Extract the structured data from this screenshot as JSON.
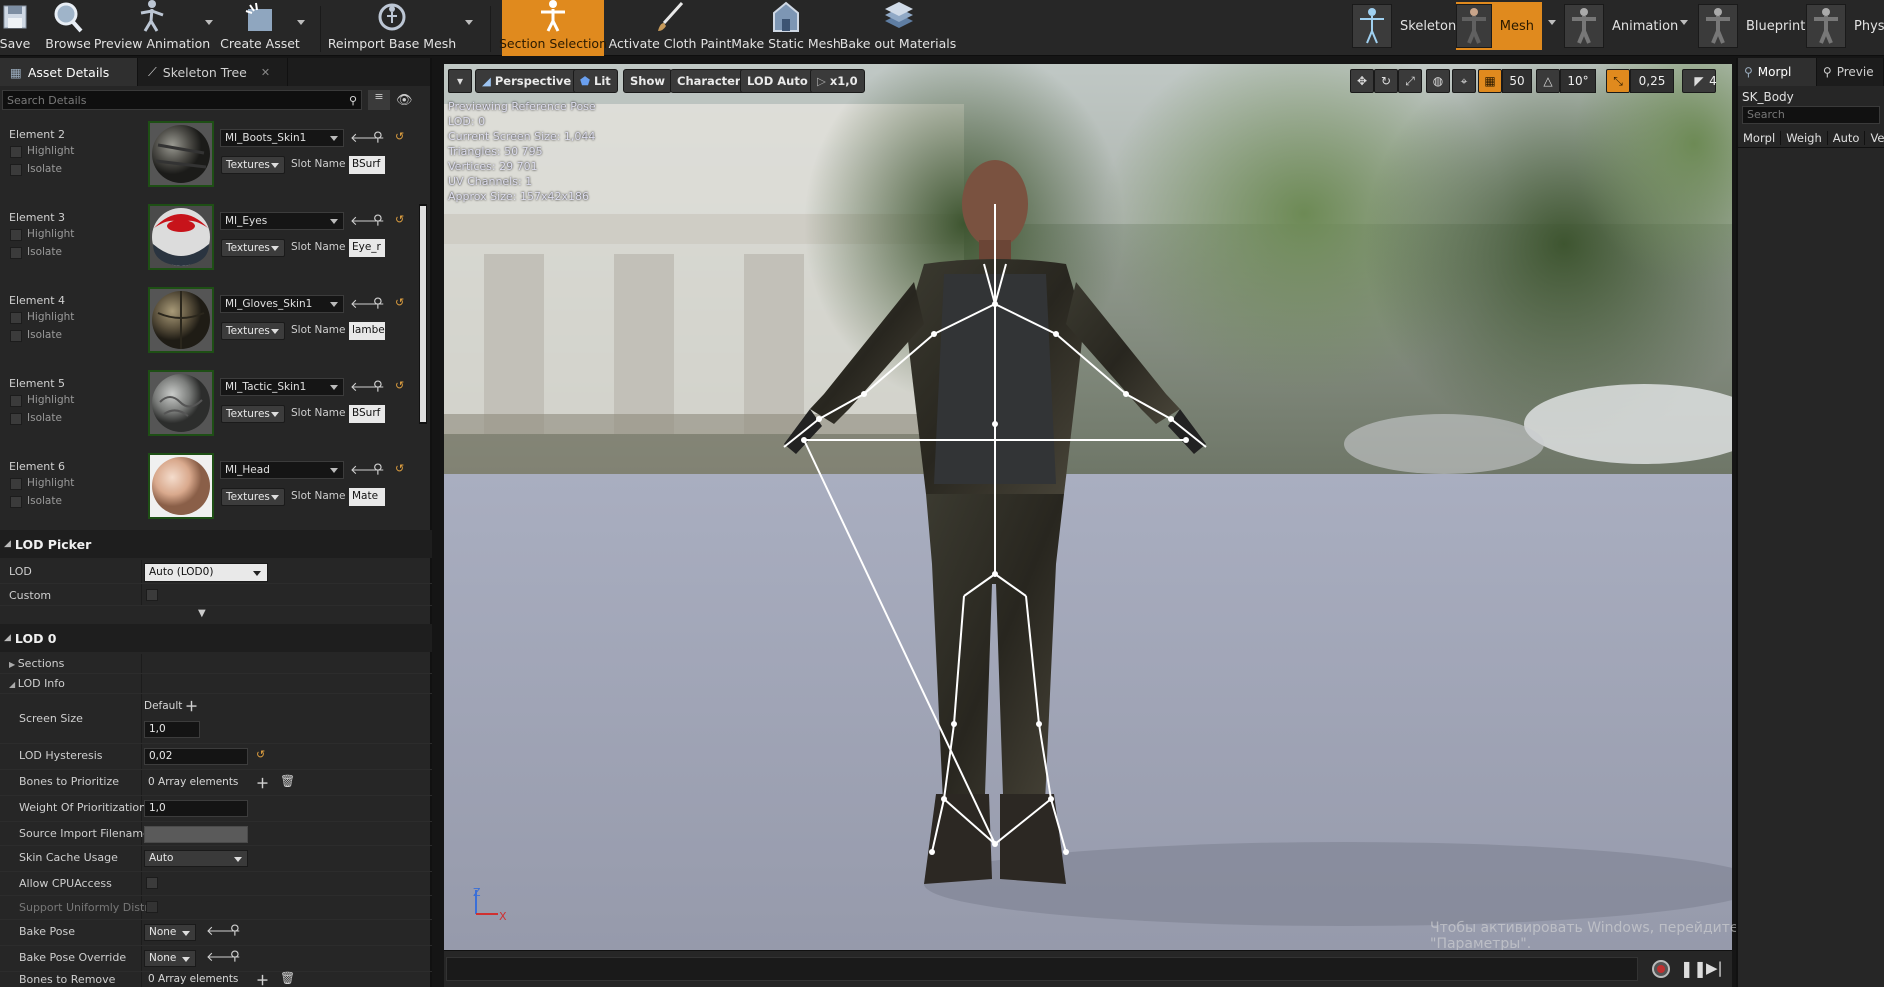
{
  "toolbar": {
    "save": "Save",
    "browse": "Browse",
    "preview_animation": "Preview Animation",
    "create_asset": "Create Asset",
    "reimport_base_mesh": "Reimport Base Mesh",
    "section_selection": "Section Selection",
    "activate_cloth_paint": "Activate Cloth Paint",
    "make_static_mesh": "Make Static Mesh",
    "bake_out_materials": "Bake out Materials"
  },
  "modes": {
    "skeleton": "Skeleton",
    "mesh": "Mesh",
    "animation": "Animation",
    "blueprint": "Blueprint",
    "physics": "Phys"
  },
  "left_panel": {
    "tabs": [
      "Asset Details",
      "Skeleton Tree"
    ],
    "search_placeholder": "Search Details",
    "elements": [
      {
        "name": "Element 2",
        "highlight": "Highlight",
        "isolate": "Isolate",
        "material": "MI_Boots_Skin1",
        "textures": "Textures",
        "slot_label": "Slot Name",
        "slot_value": "BSurf"
      },
      {
        "name": "Element 3",
        "highlight": "Highlight",
        "isolate": "Isolate",
        "material": "MI_Eyes",
        "textures": "Textures",
        "slot_label": "Slot Name",
        "slot_value": "Eye_r"
      },
      {
        "name": "Element 4",
        "highlight": "Highlight",
        "isolate": "Isolate",
        "material": "MI_Gloves_Skin1",
        "textures": "Textures",
        "slot_label": "Slot Name",
        "slot_value": "lambe"
      },
      {
        "name": "Element 5",
        "highlight": "Highlight",
        "isolate": "Isolate",
        "material": "MI_Tactic_Skin1",
        "textures": "Textures",
        "slot_label": "Slot Name",
        "slot_value": "BSurf"
      },
      {
        "name": "Element 6",
        "highlight": "Highlight",
        "isolate": "Isolate",
        "material": "MI_Head",
        "textures": "Textures",
        "slot_label": "Slot Name",
        "slot_value": "Mate"
      }
    ],
    "lod_picker": {
      "title": "LOD Picker",
      "lod_label": "LOD",
      "lod_value": "Auto (LOD0)",
      "custom_label": "Custom"
    },
    "lod0": {
      "title": "LOD 0",
      "sections": "Sections",
      "lod_info": "LOD Info",
      "screen_size_label": "Screen Size",
      "screen_size_default": "Default",
      "screen_size_value": "1,0",
      "lod_hysteresis_label": "LOD Hysteresis",
      "lod_hysteresis_value": "0,02",
      "bones_to_prioritize_label": "Bones to Prioritize",
      "bones_to_prioritize_value": "0 Array elements",
      "weight_of_prioritization_label": "Weight Of Prioritization",
      "weight_of_prioritization_value": "1,0",
      "source_import_filename_label": "Source Import Filename",
      "skin_cache_usage_label": "Skin Cache Usage",
      "skin_cache_usage_value": "Auto",
      "allow_cpu_access_label": "Allow CPUAccess",
      "support_uniformly_label": "Support Uniformly Distri",
      "bake_pose_label": "Bake Pose",
      "bake_pose_value": "None",
      "bake_pose_override_label": "Bake Pose Override",
      "bake_pose_override_value": "None",
      "bones_to_remove_label": "Bones to Remove",
      "bones_to_remove_value": "0 Array elements"
    }
  },
  "viewport": {
    "perspective": "Perspective",
    "lit": "Lit",
    "show": "Show",
    "character": "Character",
    "lod_auto": "LOD Auto",
    "play_rate": "x1,0",
    "grid_snap": "50",
    "rotation_snap": "10°",
    "scale_snap": "0,25",
    "camera_speed": "4",
    "info": [
      "Previewing Reference Pose",
      "LOD: 0",
      "Current Screen Size: 1,044",
      "Triangles: 50 795",
      "Vertices: 29 701",
      "UV Channels: 1",
      "Approx Size: 157x42x186"
    ],
    "axis_z": "Z",
    "axis_x": "X",
    "watermark": "Чтобы активировать Windows, перейдите в раздел \"Параметры\"."
  },
  "right_panel": {
    "tabs": [
      "Morpl",
      "Previe"
    ],
    "asset_name": "SK_Body",
    "search_placeholder": "Search",
    "columns": [
      "Morpl",
      "Weigh",
      "Auto",
      "Ver"
    ]
  },
  "colors": {
    "accent": "#e08a1e",
    "panel": "#262626",
    "toolbar": "#272727"
  }
}
